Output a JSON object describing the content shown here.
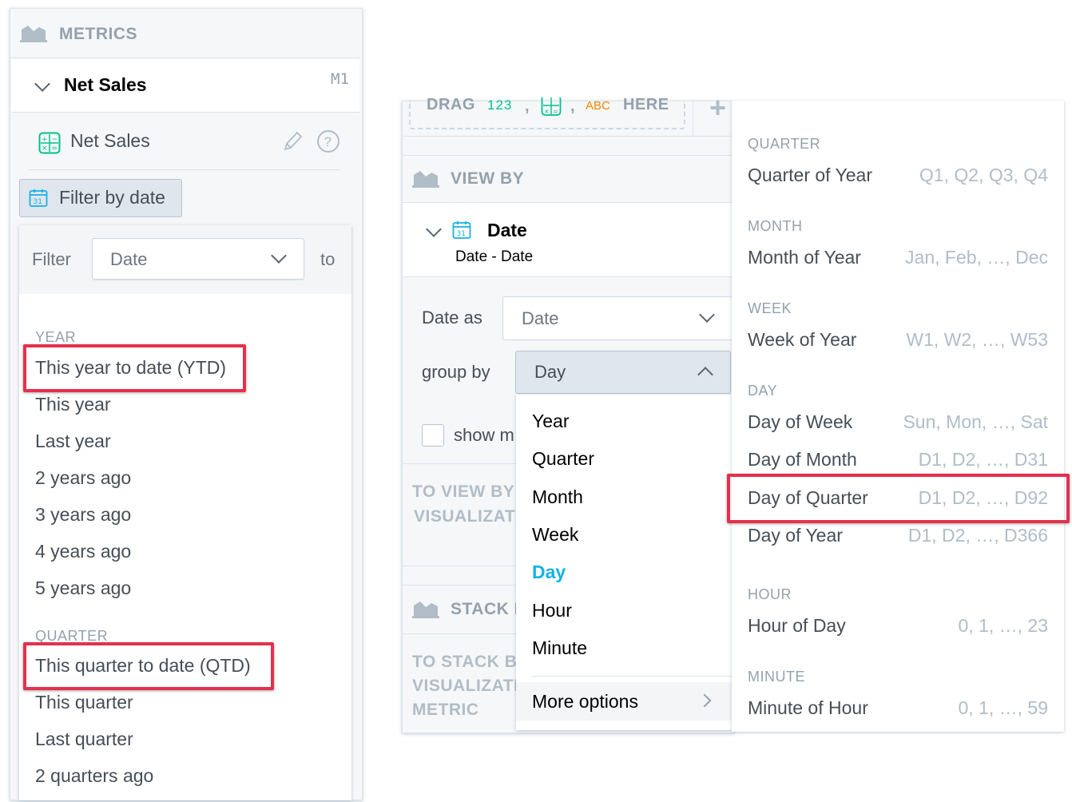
{
  "left": {
    "metrics_header": "METRICS",
    "bucket_title": "Net Sales",
    "bucket_tag": "M1",
    "measure_name": "Net Sales",
    "filter_button": "Filter by date",
    "filter_label": "Filter",
    "filter_select_value": "Date",
    "filter_to": "to",
    "year_header": "YEAR",
    "year_items": [
      "This year to date (YTD)",
      "This year",
      "Last year",
      "2 years ago",
      "3 years ago",
      "4 years ago",
      "5 years ago"
    ],
    "quarter_header": "QUARTER",
    "quarter_items": [
      "This quarter to date (QTD)",
      "This quarter",
      "Last quarter",
      "2 quarters ago"
    ]
  },
  "right": {
    "drag_word": "DRAG",
    "drag_num": "123",
    "drag_comma1": ",",
    "drag_comma2": ",",
    "drag_abc": "ABC",
    "drag_here": "HERE",
    "plus": "+",
    "view_by_header": "VIEW BY",
    "date_title": "Date",
    "date_subtitle": "Date - Date",
    "date_as_label": "Date as",
    "date_as_value": "Date",
    "group_by_label": "group by",
    "group_by_value": "Day",
    "show_label": "show m",
    "to_view_line1": "TO VIEW BY",
    "to_view_line2": "VISUALIZATI",
    "stack_header": "STACK E",
    "to_stack_line1": "TO STACK BY",
    "to_stack_line2": "VISUALIZATI",
    "to_stack_line3": "METRIC",
    "group_options": [
      "Year",
      "Quarter",
      "Month",
      "Week",
      "Day",
      "Hour",
      "Minute"
    ],
    "group_selected": "Day",
    "more_options": "More options",
    "more_sections": [
      {
        "header": "QUARTER",
        "items": [
          {
            "label": "Quarter of Year",
            "example": "Q1, Q2, Q3, Q4"
          }
        ]
      },
      {
        "header": "MONTH",
        "items": [
          {
            "label": "Month of Year",
            "example": "Jan, Feb, …, Dec"
          }
        ]
      },
      {
        "header": "WEEK",
        "items": [
          {
            "label": "Week of Year",
            "example": "W1, W2, …, W53"
          }
        ]
      },
      {
        "header": "DAY",
        "items": [
          {
            "label": "Day of Week",
            "example": "Sun, Mon, …, Sat"
          },
          {
            "label": "Day of Month",
            "example": "D1, D2, …, D31"
          },
          {
            "label": "Day of Quarter",
            "example": "D1, D2, …, D92"
          },
          {
            "label": "Day of Year",
            "example": "D1, D2, …, D366"
          }
        ]
      },
      {
        "header": "HOUR",
        "items": [
          {
            "label": "Hour of Day",
            "example": "0, 1, …, 23"
          }
        ]
      },
      {
        "header": "MINUTE",
        "items": [
          {
            "label": "Minute of Hour",
            "example": "0, 1, …, 59"
          }
        ]
      }
    ]
  },
  "colors": {
    "highlight": "#e5304d",
    "accent": "#14b2e2",
    "attribute_green": "#00c18d",
    "fact_orange": "#f38700",
    "text": "#464e56",
    "muted": "#94a1ad"
  }
}
